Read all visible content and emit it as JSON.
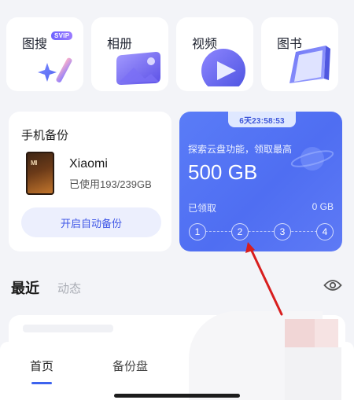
{
  "tiles": [
    {
      "label": "图搜",
      "badge": "SVIP",
      "icon": "sparkle-search-icon"
    },
    {
      "label": "相册",
      "icon": "photo-album-icon"
    },
    {
      "label": "视频",
      "icon": "video-play-icon"
    },
    {
      "label": "图书",
      "icon": "book-icon"
    }
  ],
  "backup": {
    "title": "手机备份",
    "device_name": "Xiaomi",
    "usage": "已使用193/239GB",
    "button_label": "开启自动备份",
    "phone_brand_mark": "MI"
  },
  "promo": {
    "countdown": "6天23:58:53",
    "subtitle": "探索云盘功能，领取最高",
    "amount": "500 GB",
    "claimed_label": "已领取",
    "claimed_value": "0 GB",
    "steps": [
      "1",
      "2",
      "3",
      "4"
    ]
  },
  "recent": {
    "title": "最近",
    "tab_dynamic": "动态",
    "visibility_icon": "eye-icon"
  },
  "bottom_nav": {
    "home": "首页",
    "backup_disk": "备份盘"
  },
  "colors": {
    "accent_blue": "#4f6ef2",
    "annotation_red": "#d81e1e",
    "home_indicator": "#1c1c1c"
  }
}
